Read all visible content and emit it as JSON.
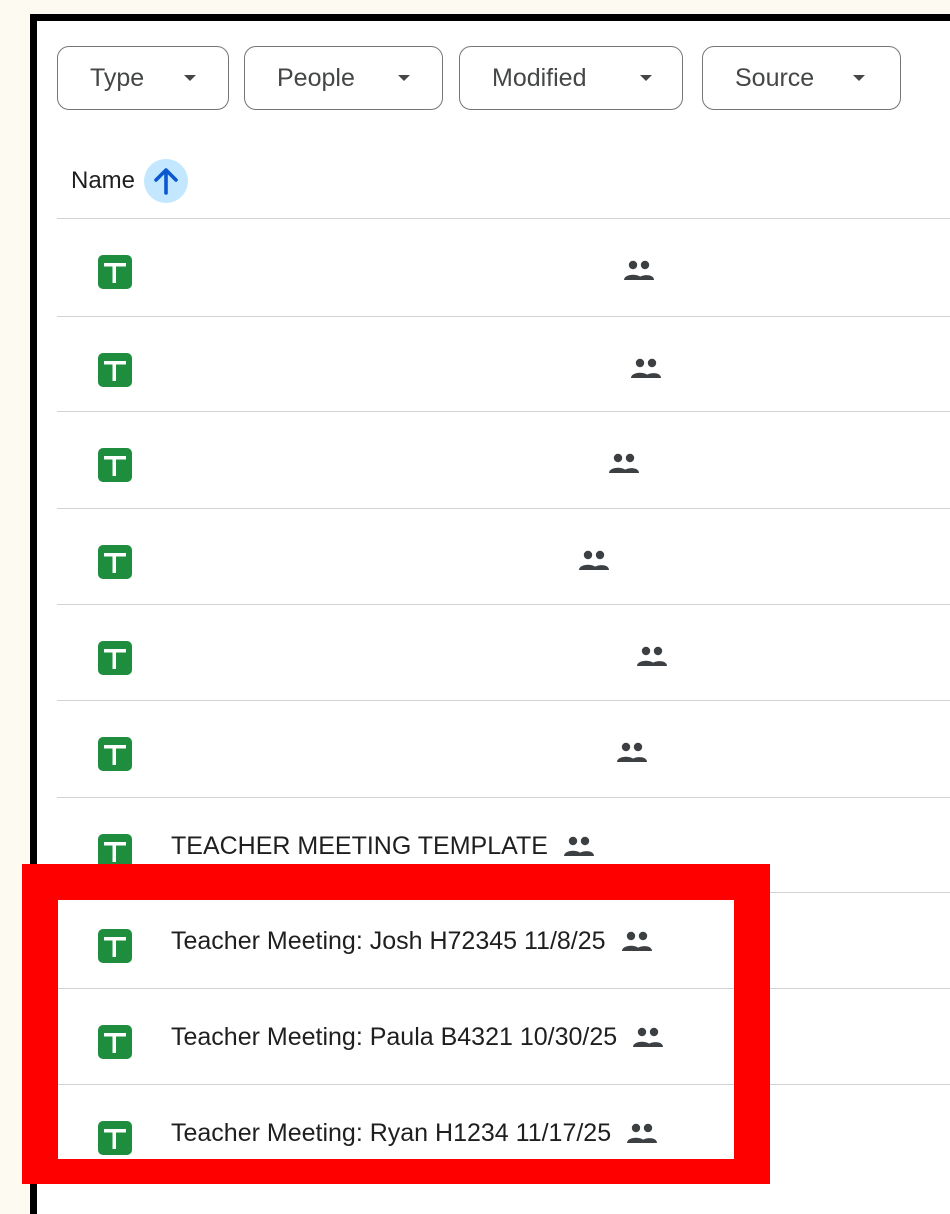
{
  "filters": [
    {
      "label": "Type"
    },
    {
      "label": "People"
    },
    {
      "label": "Modified"
    },
    {
      "label": "Source"
    }
  ],
  "header": {
    "name_label": "Name",
    "sort_direction": "ascending"
  },
  "files": [
    {
      "name": "",
      "type": "spreadsheet",
      "shared": true
    },
    {
      "name": "",
      "type": "spreadsheet",
      "shared": true
    },
    {
      "name": "",
      "type": "spreadsheet",
      "shared": true
    },
    {
      "name": "",
      "type": "spreadsheet",
      "shared": true
    },
    {
      "name": "",
      "type": "spreadsheet",
      "shared": true
    },
    {
      "name": "",
      "type": "spreadsheet",
      "shared": true
    },
    {
      "name": "TEACHER MEETING TEMPLATE",
      "type": "spreadsheet",
      "shared": true
    },
    {
      "name": "Teacher Meeting: Josh H72345 11/8/25",
      "type": "spreadsheet",
      "shared": true
    },
    {
      "name": "Teacher Meeting: Paula B4321 10/30/25",
      "type": "spreadsheet",
      "shared": true
    },
    {
      "name": "Teacher Meeting: Ryan H1234 11/17/25",
      "type": "spreadsheet",
      "shared": true
    }
  ],
  "colors": {
    "sheets_green": "#1e8e3e",
    "sort_bg": "#c2e7ff",
    "sort_arrow": "#0b57d0",
    "highlight": "#ff0000"
  },
  "icons": {
    "file": "google-sheets-icon",
    "shared": "people-icon",
    "sort": "arrow-up-icon",
    "filter_caret": "chevron-down-icon"
  }
}
